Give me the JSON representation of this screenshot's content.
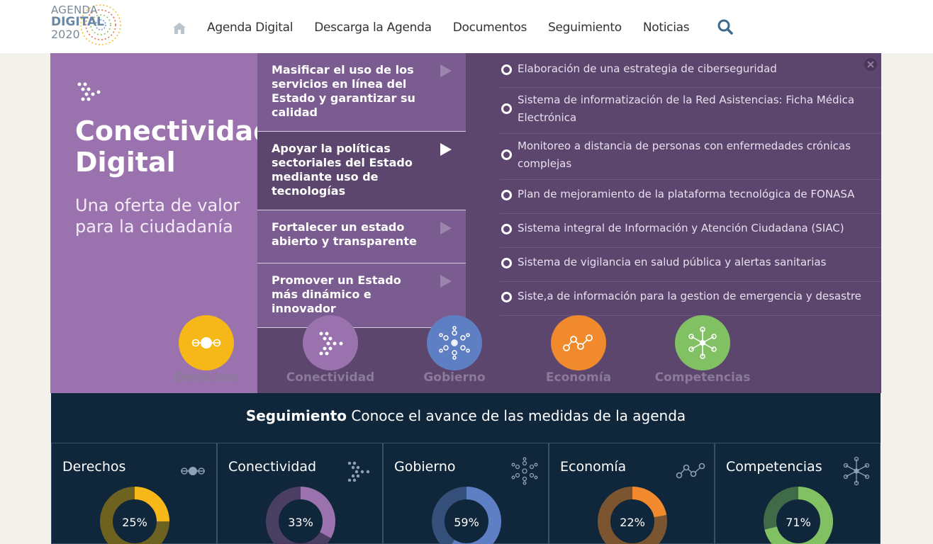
{
  "header": {
    "logo": {
      "line1": "AGENDA",
      "line2": "DIGITAL",
      "line3": "2020"
    },
    "nav": [
      "Agenda Digital",
      "Descarga la Agenda",
      "Documentos",
      "Seguimiento",
      "Noticias"
    ]
  },
  "hero": {
    "title": "Conectividad Digital",
    "subtitle": "Una oferta de valor para la ciudadanía",
    "menu": [
      {
        "label": "Masificar el uso de los servicios en línea del Estado y garantizar su calidad"
      },
      {
        "label": "Apoyar la políticas sectoriales del Estado mediante uso de tecnologías"
      },
      {
        "label": "Fortalecer un estado abierto y transparente"
      },
      {
        "label": "Promover un Estado más dinámico e innovador"
      }
    ],
    "measures": [
      "Elaboración de una estrategia de ciberseguridad",
      "Sistema de informatización de la Red Asistencias: Ficha Médica Electrónica",
      "Monitoreo a distancia de personas con enfermedades crónicas complejas",
      "Plan de mejoramiento de la plataforma tecnológica de FONASA",
      "Sistema integral de Información y Atención Ciudadana (SIAC)",
      "Sistema de vigilancia en salud pública y alertas sanitarias",
      "Siste,a de información para la gestion de emergencia y desastre"
    ],
    "categories": [
      {
        "label": "Derechos",
        "color": "#f5b818",
        "icon": "dots-line-icon"
      },
      {
        "label": "Conectividad",
        "color": "#9a72ad",
        "icon": "dots-arrow-icon"
      },
      {
        "label": "Gobierno",
        "color": "#5f7fc4",
        "icon": "network-hub-icon"
      },
      {
        "label": "Economía",
        "color": "#f08a2c",
        "icon": "zigzag-nodes-icon"
      },
      {
        "label": "Competencias",
        "color": "#82c064",
        "icon": "star-nodes-icon"
      }
    ]
  },
  "seguimiento": {
    "bold": "Seguimiento",
    "rest": " Conoce el avance de las medidas de la agenda"
  },
  "cards": [
    {
      "label": "Derechos",
      "pct": "25%",
      "value": 25,
      "color": "#f5b818",
      "track": "#6e6221"
    },
    {
      "label": "Conectividad",
      "pct": "33%",
      "value": 33,
      "color": "#9a72ad",
      "track": "#4a3f63"
    },
    {
      "label": "Gobierno",
      "pct": "59%",
      "value": 59,
      "color": "#5f7fc4",
      "track": "#35507a"
    },
    {
      "label": "Economía",
      "pct": "22%",
      "value": 22,
      "color": "#f08a2c",
      "track": "#7a5530"
    },
    {
      "label": "Competencias",
      "pct": "71%",
      "value": 71,
      "color": "#82c064",
      "track": "#3f6b48"
    }
  ]
}
